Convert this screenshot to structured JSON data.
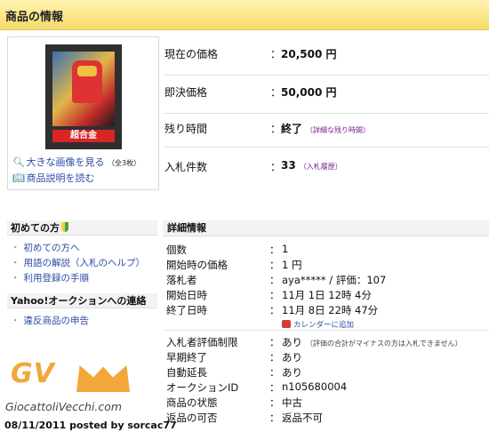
{
  "header": {
    "title": "商品の情報"
  },
  "product": {
    "image_label": "超合金",
    "links": [
      {
        "text": "大きな画像を見る",
        "note": "（全3枚）"
      },
      {
        "text": "商品説明を読む"
      }
    ]
  },
  "summary": [
    {
      "label": "現在の価格",
      "value": "20,500 円",
      "sub": ""
    },
    {
      "label": "即決価格",
      "value": "50,000 円",
      "sub": ""
    },
    {
      "label": "残り時間",
      "value": "終了",
      "sub": "（詳細な残り時間）"
    },
    {
      "label": "入札件数",
      "value": "33",
      "sub": "（入札履歴）"
    }
  ],
  "sidebar": {
    "beginner": {
      "heading": "初めての方",
      "items": [
        "初めての方へ",
        "用語の解説（入札のヘルプ）",
        "利用登録の手順"
      ]
    },
    "contact": {
      "heading": "Yahoo!オークションへの連絡",
      "items": [
        "違反商品の申告"
      ]
    }
  },
  "details": {
    "heading": "詳細情報",
    "rows": [
      {
        "label": "個数",
        "value": "1"
      },
      {
        "label": "開始時の価格",
        "value": "1 円"
      },
      {
        "label": "落札者",
        "value": "aya***** / 評価：107"
      },
      {
        "label": "開始日時",
        "value": "11月 1日 12時 4分"
      },
      {
        "label": "終了日時",
        "value": "11月 8日 22時 47分"
      },
      {
        "label": "入札者評価制限",
        "value": "あり",
        "note": "（評価の合計がマイナスの方は入札できません）"
      },
      {
        "label": "早期終了",
        "value": "あり"
      },
      {
        "label": "自動延長",
        "value": "あり"
      },
      {
        "label": "オークションID",
        "value": "n105680004"
      },
      {
        "label": "商品の状態",
        "value": "中古"
      },
      {
        "label": "返品の可否",
        "value": "返品不可"
      }
    ],
    "calendar_link": "カレンダーに追加"
  },
  "watermark": {
    "logo": "GV",
    "site": "GiocattoliVecchi.com",
    "credit": "08/11/2011 posted by sorcac77"
  }
}
